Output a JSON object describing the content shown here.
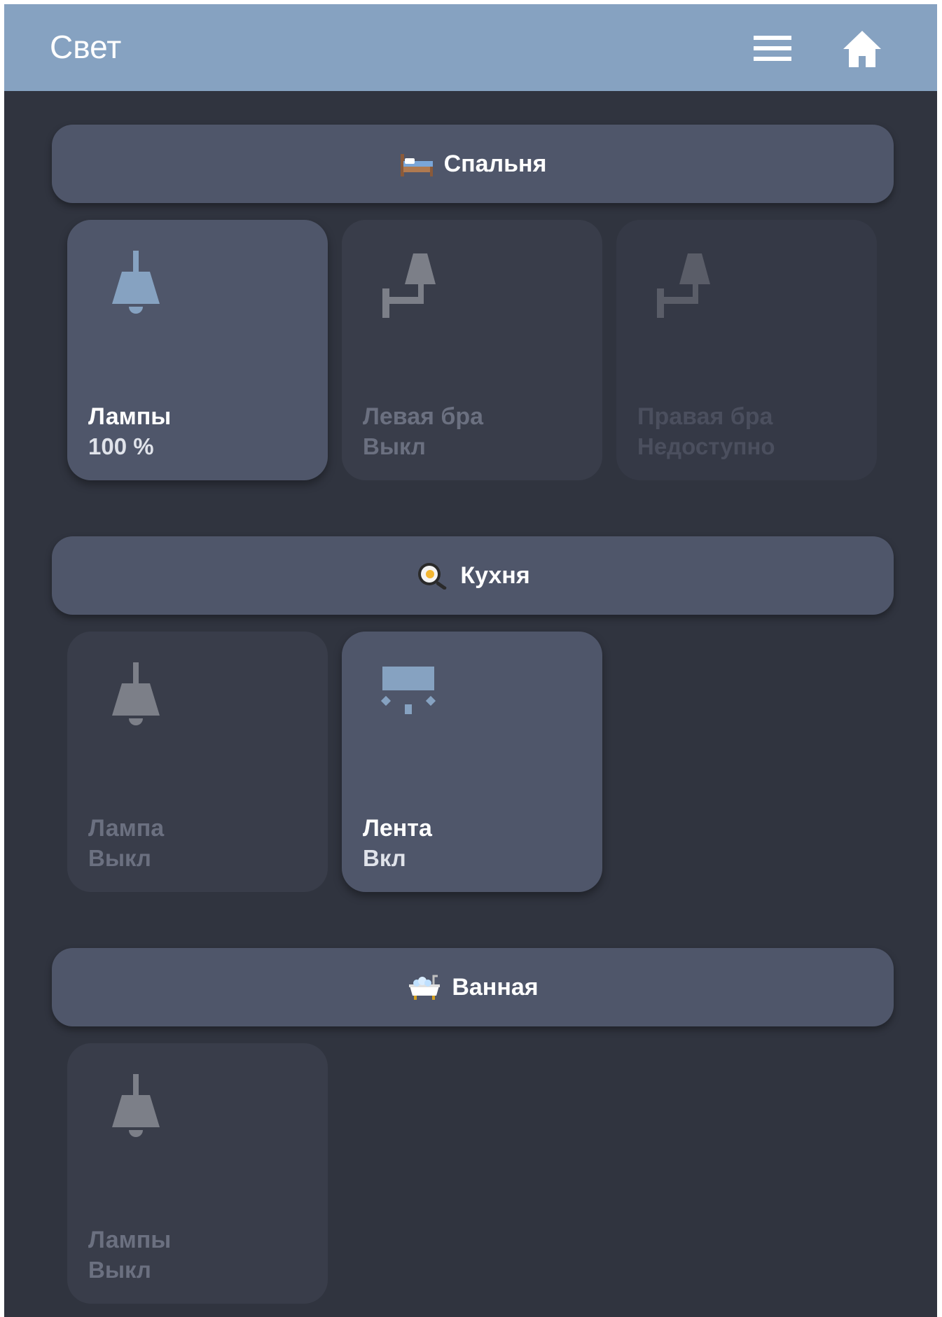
{
  "topbar": {
    "title": "Свет",
    "menu_icon": "menu-icon",
    "home_icon": "home-icon",
    "bg_color": "#86a2c1"
  },
  "colors": {
    "background": "#30343f",
    "card_on": "#4f566a",
    "card_off": "#393d4a",
    "icon_on": "#86a2c1",
    "icon_off": "#7c7f88"
  },
  "rooms": [
    {
      "name": "Спальня",
      "emoji_icon": "bed-icon",
      "devices": [
        {
          "name": "Лампы",
          "state": "100 %",
          "icon": "pendant-lamp-icon",
          "status": "on"
        },
        {
          "name": "Левая бра",
          "state": "Выкл",
          "icon": "wall-sconce-icon",
          "status": "off"
        },
        {
          "name": "Правая бра",
          "state": "Недоступно",
          "icon": "wall-sconce-icon",
          "status": "unavailable"
        }
      ]
    },
    {
      "name": "Кухня",
      "emoji_icon": "frying-pan-icon",
      "devices": [
        {
          "name": "Лампа",
          "state": "Выкл",
          "icon": "pendant-lamp-icon",
          "status": "off"
        },
        {
          "name": "Лента",
          "state": "Вкл",
          "icon": "ceiling-light-icon",
          "status": "on"
        }
      ]
    },
    {
      "name": "Ванная",
      "emoji_icon": "bathtub-icon",
      "devices": [
        {
          "name": "Лампы",
          "state": "Выкл",
          "icon": "pendant-lamp-icon",
          "status": "off"
        }
      ]
    }
  ]
}
